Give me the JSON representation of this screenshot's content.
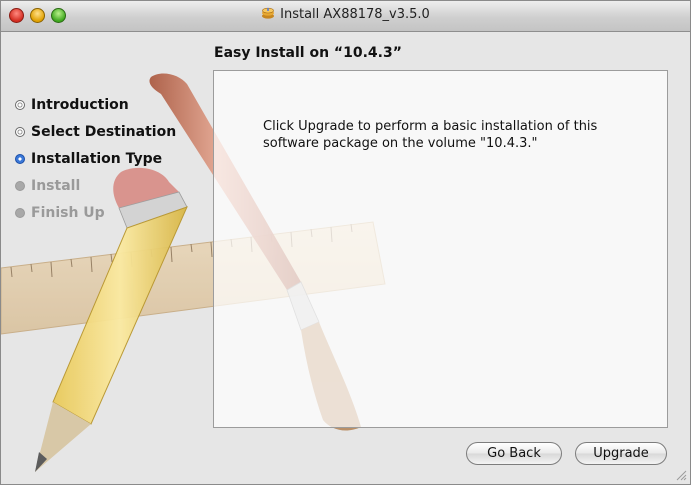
{
  "window": {
    "title": "Install AX88178_v3.5.0",
    "app_icon": "package-installer-icon"
  },
  "heading": "Easy Install on “10.4.3”",
  "steps": [
    {
      "label": "Introduction",
      "state": "done"
    },
    {
      "label": "Select Destination",
      "state": "done"
    },
    {
      "label": "Installation Type",
      "state": "current"
    },
    {
      "label": "Install",
      "state": "future"
    },
    {
      "label": "Finish Up",
      "state": "future"
    }
  ],
  "panel": {
    "text": "Click Upgrade to perform a basic installation of this software package on the volume \"10.4.3.\""
  },
  "buttons": {
    "back": "Go Back",
    "primary": "Upgrade"
  },
  "colors": {
    "current_step": "#3b78d8",
    "close": "#d32c20",
    "minimize": "#e0a000",
    "zoom": "#3ea71e"
  }
}
